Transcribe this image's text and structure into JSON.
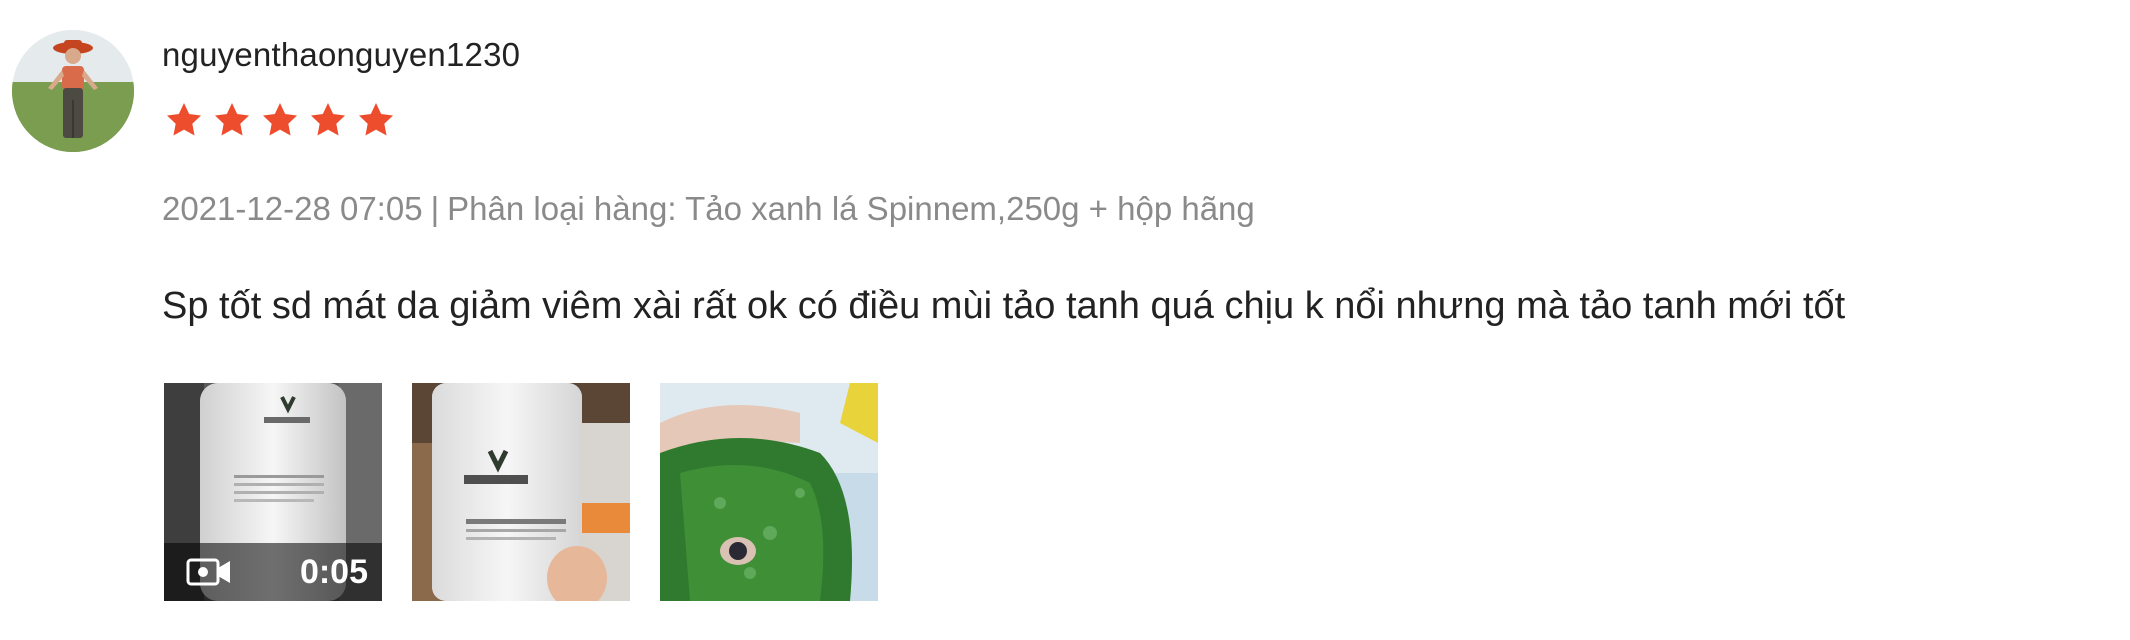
{
  "review": {
    "username": "nguyenthaonguyen1230",
    "rating": 5,
    "rating_max": 5,
    "star_color": "#ee4d2d",
    "timestamp": "2021-12-28 07:05",
    "separator": "|",
    "variation": "Phân loại hàng: Tảo xanh lá Spinnem,250g + hộp hãng",
    "comment": "Sp tốt sd mát da giảm viêm xài rất ok có điều mùi tảo tanh quá chịu k nổi nhưng mà tảo tanh mới tốt",
    "media": [
      {
        "type": "video",
        "duration": "0:05",
        "icon": "video-camera-icon"
      },
      {
        "type": "image"
      },
      {
        "type": "image"
      }
    ]
  }
}
